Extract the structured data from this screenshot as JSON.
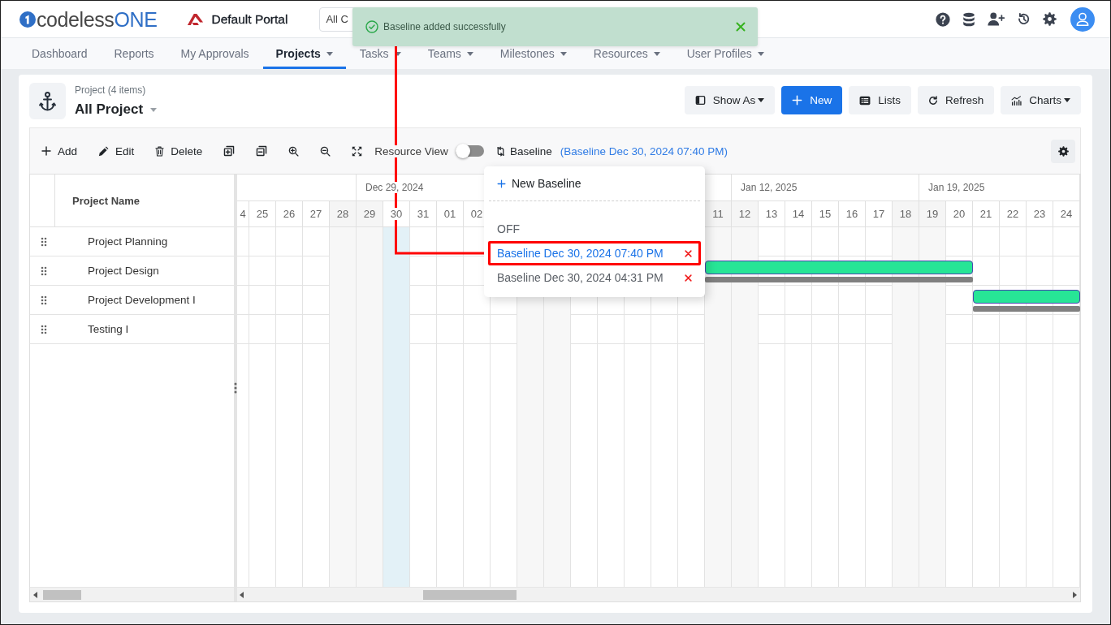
{
  "header": {
    "logo": {
      "text": "codeless",
      "accent": "ONE"
    },
    "portal": "Default Portal",
    "scope": "All C"
  },
  "toast": {
    "kind": "success",
    "message": "Baseline added successfully"
  },
  "nav": [
    {
      "label": "Dashboard",
      "selected": false,
      "dropdown": false
    },
    {
      "label": "Reports",
      "selected": false,
      "dropdown": false
    },
    {
      "label": "My Approvals",
      "selected": false,
      "dropdown": false
    },
    {
      "label": "Projects",
      "selected": true,
      "dropdown": true
    },
    {
      "label": "Tasks",
      "selected": false,
      "dropdown": true
    },
    {
      "label": "Teams",
      "selected": false,
      "dropdown": true
    },
    {
      "label": "Milestones",
      "selected": false,
      "dropdown": true
    },
    {
      "label": "Resources",
      "selected": false,
      "dropdown": true
    },
    {
      "label": "User Profiles",
      "selected": false,
      "dropdown": true
    }
  ],
  "view": {
    "subtitle": "Project (4 items)",
    "title": "All Project"
  },
  "actions": [
    {
      "label": "Show As",
      "kind": "menu"
    },
    {
      "label": "New",
      "kind": "primary"
    },
    {
      "label": "Lists",
      "kind": "plain"
    },
    {
      "label": "Refresh",
      "kind": "plain"
    },
    {
      "label": "Charts",
      "kind": "menu"
    }
  ],
  "toolbar": {
    "buttons": [
      "Add",
      "Edit",
      "Delete"
    ],
    "resource_view": {
      "label": "Resource View",
      "on": false
    },
    "baseline": {
      "label": "Baseline",
      "current": "(Baseline Dec 30, 2024 07:40 PM)"
    }
  },
  "baseline_menu": {
    "new_label": "New Baseline",
    "items": [
      {
        "kind": "off",
        "label": "OFF",
        "selected": false,
        "highlighted": false
      },
      {
        "kind": "saved",
        "label": "Baseline Dec 30, 2024 07:40 PM",
        "selected": true,
        "highlighted": true
      },
      {
        "kind": "saved",
        "label": "Baseline Dec 30, 2024 04:31 PM",
        "selected": false,
        "highlighted": false
      }
    ]
  },
  "grid": {
    "column": "Project Name",
    "rows": [
      {
        "name": "Project Planning"
      },
      {
        "name": "Project Design",
        "baseline": true,
        "cells": [
          {
            "kind": "empty"
          },
          {
            "kind": "empty"
          },
          {
            "kind": "empty"
          },
          {
            "kind": "empty"
          },
          {
            "kind": "empty"
          },
          {
            "kind": "empty"
          },
          {
            "kind": "empty"
          },
          {
            "kind": "empty"
          },
          {
            "kind": "empty"
          },
          {
            "kind": "empty"
          },
          {
            "kind": "empty"
          },
          {
            "kind": "empty"
          },
          {
            "kind": "empty"
          },
          {
            "kind": "empty"
          },
          {
            "kind": "empty"
          },
          {
            "kind": "empty"
          },
          {
            "kind": "empty"
          },
          {
            "kind": "empty"
          },
          {
            "kind": "task"
          },
          {
            "kind": "task"
          },
          {
            "kind": "task"
          },
          {
            "kind": "task"
          },
          {
            "kind": "task"
          },
          {
            "kind": "task"
          },
          {
            "kind": "task"
          },
          {
            "kind": "task"
          },
          {
            "kind": "task"
          },
          {
            "kind": "task"
          },
          {
            "kind": "empty"
          },
          {
            "kind": "empty"
          },
          {
            "kind": "empty"
          },
          {
            "kind": "empty"
          }
        ]
      },
      {
        "name": "Project Development I",
        "baseline": true,
        "cells": [
          {
            "kind": "empty"
          },
          {
            "kind": "empty"
          },
          {
            "kind": "empty"
          },
          {
            "kind": "empty"
          },
          {
            "kind": "empty"
          },
          {
            "kind": "empty"
          },
          {
            "kind": "empty"
          },
          {
            "kind": "empty"
          },
          {
            "kind": "empty"
          },
          {
            "kind": "empty"
          },
          {
            "kind": "empty"
          },
          {
            "kind": "empty"
          },
          {
            "kind": "empty"
          },
          {
            "kind": "empty"
          },
          {
            "kind": "empty"
          },
          {
            "kind": "empty"
          },
          {
            "kind": "empty"
          },
          {
            "kind": "empty"
          },
          {
            "kind": "empty"
          },
          {
            "kind": "empty"
          },
          {
            "kind": "empty"
          },
          {
            "kind": "empty"
          },
          {
            "kind": "empty"
          },
          {
            "kind": "empty"
          },
          {
            "kind": "empty"
          },
          {
            "kind": "empty"
          },
          {
            "kind": "empty"
          },
          {
            "kind": "empty"
          },
          {
            "kind": "task"
          },
          {
            "kind": "task"
          },
          {
            "kind": "task"
          },
          {
            "kind": "task"
          }
        ]
      },
      {
        "name": "Testing I"
      }
    ]
  },
  "timeline": {
    "weeks": [
      {
        "days": [
          {
            "label": "4",
            "kind": "workday"
          },
          {
            "label": "25",
            "kind": "workday"
          },
          {
            "label": "26",
            "kind": "workday"
          },
          {
            "label": "27",
            "kind": "workday"
          },
          {
            "label": "28",
            "kind": "weekend"
          }
        ]
      },
      {
        "label": "Dec 29, 2024",
        "days": [
          {
            "label": "29",
            "kind": "weekend"
          },
          {
            "label": "30",
            "kind": "today"
          },
          {
            "label": "31",
            "kind": "workday"
          },
          {
            "label": "01",
            "kind": "workday"
          },
          {
            "label": "02",
            "kind": "workday"
          },
          {
            "kind": "workday"
          },
          {
            "kind": "weekend"
          }
        ]
      },
      {
        "days": [
          {
            "kind": "weekend"
          },
          {
            "kind": "workday"
          },
          {
            "kind": "workday"
          },
          {
            "kind": "workday"
          },
          {
            "kind": "workday"
          },
          {
            "kind": "workday"
          },
          {
            "label": "11",
            "kind": "weekend"
          }
        ]
      },
      {
        "label": "Jan 12, 2025",
        "days": [
          {
            "label": "12",
            "kind": "weekend"
          },
          {
            "label": "13",
            "kind": "workday"
          },
          {
            "label": "14",
            "kind": "workday"
          },
          {
            "label": "15",
            "kind": "workday"
          },
          {
            "label": "16",
            "kind": "workday"
          },
          {
            "label": "17",
            "kind": "workday"
          },
          {
            "label": "18",
            "kind": "weekend"
          }
        ]
      },
      {
        "label": "Jan 19, 2025",
        "days": [
          {
            "label": "19",
            "kind": "weekend"
          },
          {
            "label": "20",
            "kind": "workday"
          },
          {
            "label": "21",
            "kind": "workday"
          },
          {
            "label": "22",
            "kind": "workday"
          },
          {
            "label": "23",
            "kind": "workday"
          },
          {
            "label": "24",
            "kind": "workday"
          }
        ]
      }
    ]
  }
}
